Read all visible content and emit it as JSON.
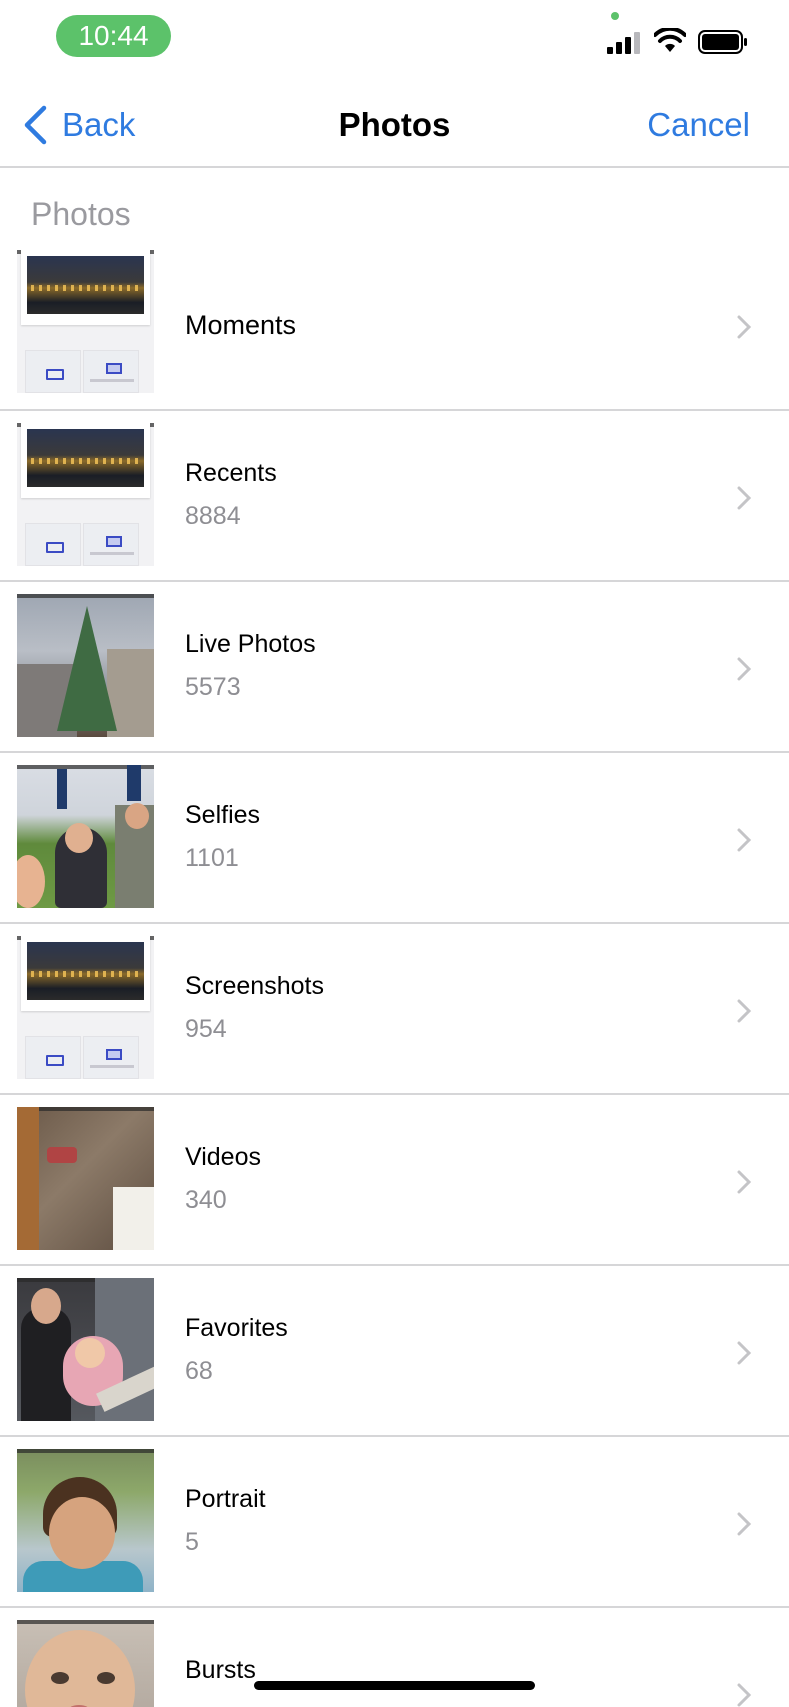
{
  "status_bar": {
    "time": "10:44"
  },
  "nav": {
    "back_label": "Back",
    "title": "Photos",
    "cancel_label": "Cancel"
  },
  "section": {
    "header": "Photos"
  },
  "albums": [
    {
      "name": "Moments",
      "count": "",
      "thumb": "city-screenshot"
    },
    {
      "name": "Recents",
      "count": "8884",
      "thumb": "city-screenshot"
    },
    {
      "name": "Live Photos",
      "count": "5573",
      "thumb": "christmas-tree"
    },
    {
      "name": "Selfies",
      "count": "1101",
      "thumb": "selfie-group"
    },
    {
      "name": "Screenshots",
      "count": "954",
      "thumb": "city-screenshot"
    },
    {
      "name": "Videos",
      "count": "340",
      "thumb": "shop-window"
    },
    {
      "name": "Favorites",
      "count": "68",
      "thumb": "mother-child"
    },
    {
      "name": "Portrait",
      "count": "5",
      "thumb": "child-portrait"
    },
    {
      "name": "Bursts",
      "count": "",
      "thumb": "baby-face"
    }
  ],
  "colors": {
    "accent": "#2f7be0",
    "time_pill": "#5cc26a",
    "secondary_text": "#8e8e93",
    "separator": "#d6d6d8"
  }
}
